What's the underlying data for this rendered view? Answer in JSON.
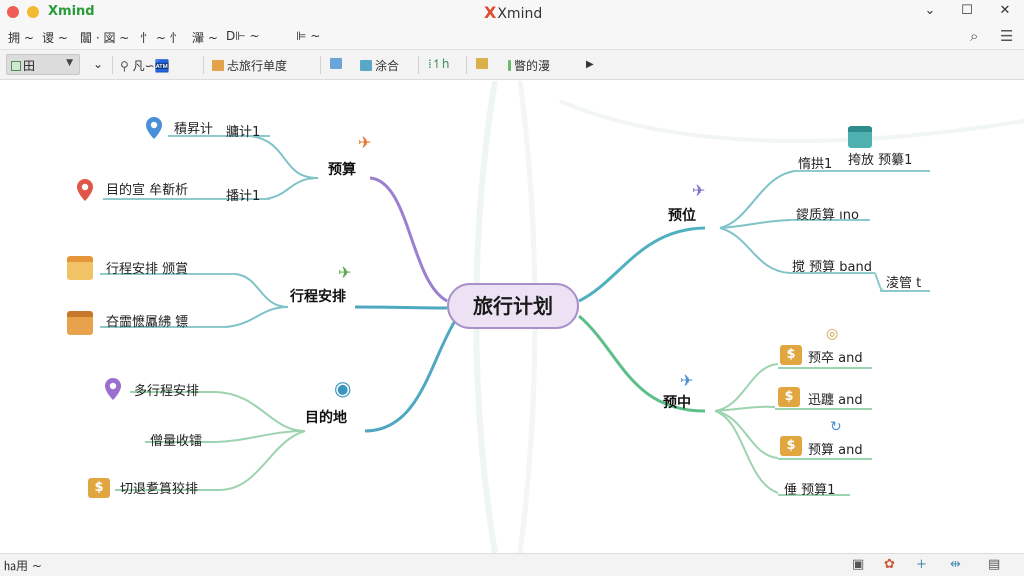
{
  "window": {
    "app_name": "Xmind",
    "title": "Xmind"
  },
  "menu": [
    "拥 ~",
    "谡 ~",
    "闒 · 図 ~",
    "忄 ~ 忄",
    "瀈 ~",
    "D⊩ ~",
    "⊫ ~"
  ],
  "toolbar": {
    "view_label": "田",
    "items": [
      {
        "label": "凡∽🏧",
        "icon": "search-icon"
      },
      {
        "label": "忐旅行单度",
        "icon": "marker-icon"
      },
      {
        "label": "涂合",
        "icon": "format-icon"
      },
      {
        "label": "⁞↿h",
        "icon": "layout-icon"
      },
      {
        "label": "瞥的漫",
        "icon": "outline-icon"
      }
    ]
  },
  "mindmap": {
    "central": "旅行计划",
    "branches": {
      "budget": {
        "label": "预算",
        "children": [
          "積昇计",
          "目的宣 牟斱析"
        ],
        "sub": [
          "牅计1",
          "播计1"
        ]
      },
      "itinerary": {
        "label": "行程安排",
        "children": [
          "行程安排 颁賞",
          "夻霝懡屭紼 镖"
        ]
      },
      "destination": {
        "label": "目的地",
        "children": [
          "多行程安排",
          "僧量收镭",
          "切退乽篔狡排"
        ]
      },
      "location": {
        "label": "预位",
        "children": [
          "惰拱1",
          "鑁质算 ıno",
          "搅 预算 band"
        ],
        "sub": [
          "挎放 预纂1",
          "淩管 t"
        ]
      },
      "middle": {
        "label": "预中",
        "children": [
          "预卒 and",
          "迅躔 and",
          "预算 and",
          "倕 预算1"
        ]
      }
    }
  },
  "status": {
    "left_label": "㏊用 ~"
  },
  "colors": {
    "purple": "#9b7fd0",
    "teal": "#4fb0c0",
    "green": "#5cbf8a",
    "accent": "#e04b2f"
  }
}
